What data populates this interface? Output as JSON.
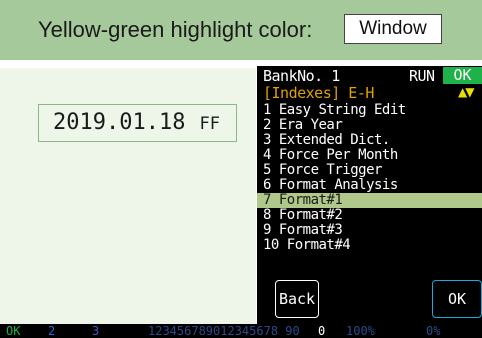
{
  "banner": {
    "label": "Yellow-green highlight color:",
    "button_label": "Window"
  },
  "preview": {
    "date": "2019.01.18",
    "suffix": "FF"
  },
  "device": {
    "bank_label": "BankNo. 1",
    "run_label": "RUN",
    "ok_status": "OK",
    "category": "[Indexes] E-H",
    "arrows": "▲▼",
    "items": [
      "1 Easy String Edit",
      "2 Era Year",
      "3 Extended Dict.",
      "4 Force Per Month",
      "5 Force Trigger",
      "6 Format Analysis",
      "7 Format#1",
      "8 Format#2",
      "9 Format#3",
      "10 Format#4"
    ],
    "selected_index": 6,
    "back_button": "Back",
    "ok_button": "OK"
  },
  "status_strip": {
    "ok": "OK",
    "num2": "2",
    "num3": "3",
    "digits": "123456789012345678 90",
    "zero": "0",
    "pct1": "100%",
    "pct2": "0%"
  },
  "colors": {
    "banner_bg": "#a6c99b",
    "highlight": "#b0c98a",
    "ok_green": "#1fb24a",
    "category_orange": "#e0a000"
  }
}
